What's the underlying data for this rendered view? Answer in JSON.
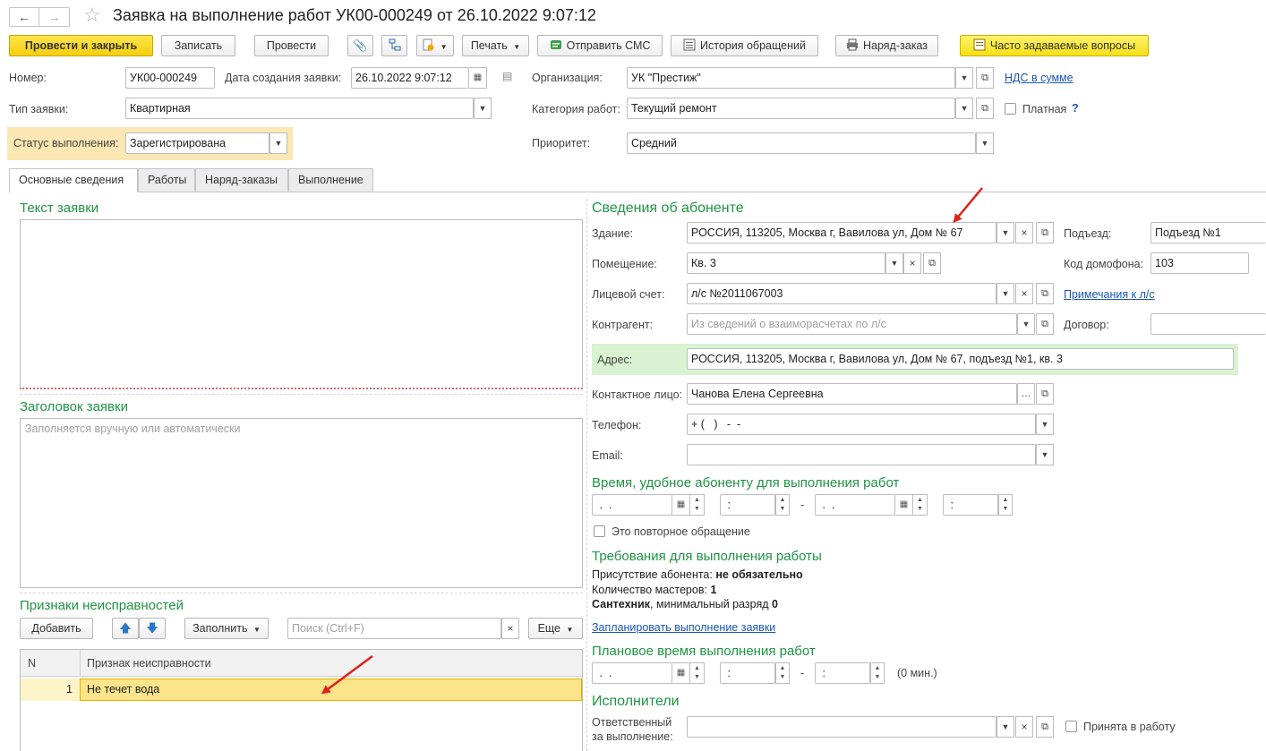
{
  "window": {
    "title": "Заявка на выполнение работ УК00-000249 от 26.10.2022 9:07:12"
  },
  "toolbar": {
    "post_close": "Провести и закрыть",
    "save": "Записать",
    "post": "Провести",
    "print": "Печать",
    "send_sms": "Отправить СМС",
    "history": "История обращений",
    "work_order": "Наряд-заказ",
    "faq": "Часто задаваемые вопросы"
  },
  "header": {
    "number_label": "Номер:",
    "number_value": "УК00-000249",
    "date_label": "Дата создания заявки:",
    "date_value": "26.10.2022  9:07:12",
    "org_label": "Организация:",
    "org_value": "УК \"Престиж\"",
    "vat_link": "НДС в сумме",
    "type_label": "Тип заявки:",
    "type_value": "Квартирная",
    "category_label": "Категория работ:",
    "category_value": "Текущий ремонт",
    "paid_label": "Платная",
    "help_mark": "?",
    "status_label": "Статус выполнения:",
    "status_value": "Зарегистрирована",
    "priority_label": "Приоритет:",
    "priority_value": "Средний"
  },
  "tabs": [
    {
      "label": "Основные сведения",
      "active": true
    },
    {
      "label": "Работы",
      "active": false
    },
    {
      "label": "Наряд-заказы",
      "active": false
    },
    {
      "label": "Выполнение",
      "active": false
    }
  ],
  "left": {
    "request_text_title": "Текст заявки",
    "request_header_title": "Заголовок заявки",
    "request_header_placeholder": "Заполняется вручную или автоматически",
    "faults_title": "Признаки неисправностей",
    "add_button": "Добавить",
    "fill_button": "Заполнить",
    "search_placeholder": "Поиск (Ctrl+F)",
    "more_button": "Еще",
    "table": {
      "columns": [
        "N",
        "Признак неисправности"
      ],
      "rows": [
        {
          "n": "1",
          "fault": "Не течет вода"
        }
      ]
    }
  },
  "right": {
    "subscriber_title": "Сведения об абоненте",
    "building_label": "Здание:",
    "building_value": "РОССИЯ, 113205, Москва г, Вавилова ул, Дом № 67",
    "entrance_label": "Подъезд:",
    "entrance_value": "Подъезд №1",
    "room_label": "Помещение:",
    "room_value": "Кв. 3",
    "intercom_label": "Код домофона:",
    "intercom_value": "103",
    "account_label": "Лицевой счет:",
    "account_value": "л/с №2011067003",
    "account_notes_link": "Примечания к л/с",
    "counterparty_label": "Контрагент:",
    "counterparty_placeholder": "Из сведений о взаиморасчетах по л/с",
    "contract_label": "Договор:",
    "address_label": "Адрес:",
    "address_value": "РОССИЯ, 113205, Москва г, Вавилова ул, Дом № 67, подъезд №1, кв. 3",
    "contact_label": "Контактное лицо:",
    "contact_value": "Чанова Елена Сергеевна",
    "phone_label": "Телефон:",
    "phone_value": "+ (   )   -  -",
    "email_label": "Email:",
    "time_title": "Время, удобное абоненту для выполнения работ",
    "date_mask": " .  .",
    "time_mask": " :",
    "dash": "-",
    "repeat_label": "Это повторное обращение",
    "requirements_title": "Требования для выполнения работы",
    "presence_label": "Присутствие абонента:",
    "presence_value": "не обязательно",
    "masters_label": "Количество мастеров:",
    "masters_value": "1",
    "plumber_label": "Сантехник",
    "grade_label": ", минимальный разряд",
    "grade_value": "0",
    "plan_link": "Запланировать выполнение заявки",
    "plan_time_title": "Плановое время выполнения работ",
    "plan_duration": "(0 мин.)",
    "performers_title": "Исполнители",
    "responsible_label_1": "Ответственный",
    "responsible_label_2": "за выполнение:",
    "accepted_label": "Принята в работу"
  },
  "colors": {
    "primary_button": "#f5cf0e",
    "section_green": "#1f9444",
    "status_highlight": "#fbe7b3",
    "address_highlight": "#d9f2d2",
    "selected_row": "#fbe48a",
    "annotation_arrow": "#e0201b"
  }
}
